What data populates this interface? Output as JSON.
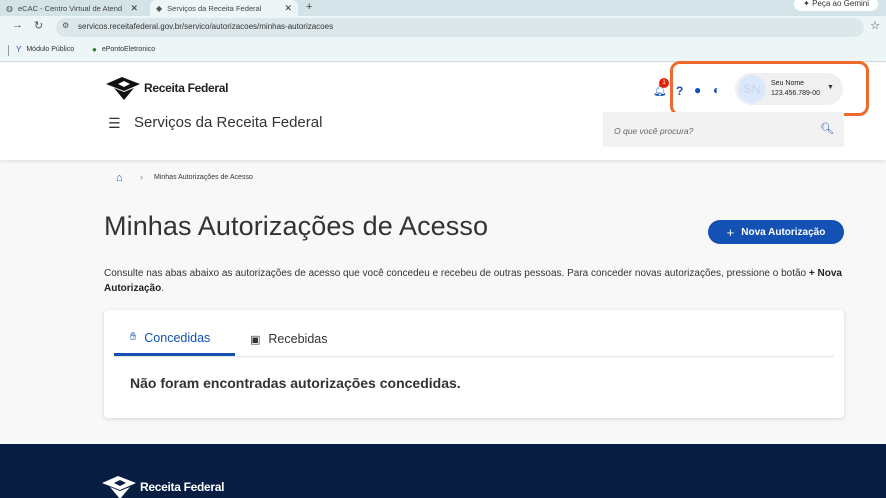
{
  "browser": {
    "tabs": [
      {
        "label": "eCAC - Centro Virtual de Atend"
      },
      {
        "label": "Serviços da Receita Federal"
      }
    ],
    "gemini_label": "Peça ao Gemini",
    "url": "servicos.receitafederal.gov.br/servico/autorizacoes/minhas-autorizacoes",
    "bookmarks": [
      {
        "label": "Módulo Público"
      },
      {
        "label": "ePontoEletronico"
      }
    ]
  },
  "header": {
    "logo_text": "Receita Federal",
    "site_title": "Serviços da Receita Federal",
    "notification_count": "1",
    "help_label": "?",
    "user": {
      "initials": "SN",
      "name": "Seu Nome",
      "cpf": "123.456.789-00"
    },
    "search_placeholder": "O que você procura?"
  },
  "breadcrumb": {
    "current": "Minhas Autorizações de Acesso"
  },
  "main": {
    "title": "Minhas Autorizações de Acesso",
    "new_button": "Nova Autorização",
    "description": "Consulte nas abas abaixo as autorizações de acesso que você concedeu e recebeu de outras pessoas. Para conceder novas autorizações, pressione o botão",
    "description_button": "Nova Autorização",
    "tabs": [
      {
        "label": "Concedidas"
      },
      {
        "label": "Recebidas"
      }
    ],
    "empty_message": "Não foram encontradas autorizações concedidas."
  },
  "footer": {
    "logo_text": "Receita Federal"
  },
  "colors": {
    "primary": "#1351b4",
    "footer_bg": "#071d41",
    "highlight": "#ee6a2c",
    "badge": "#e52207"
  }
}
